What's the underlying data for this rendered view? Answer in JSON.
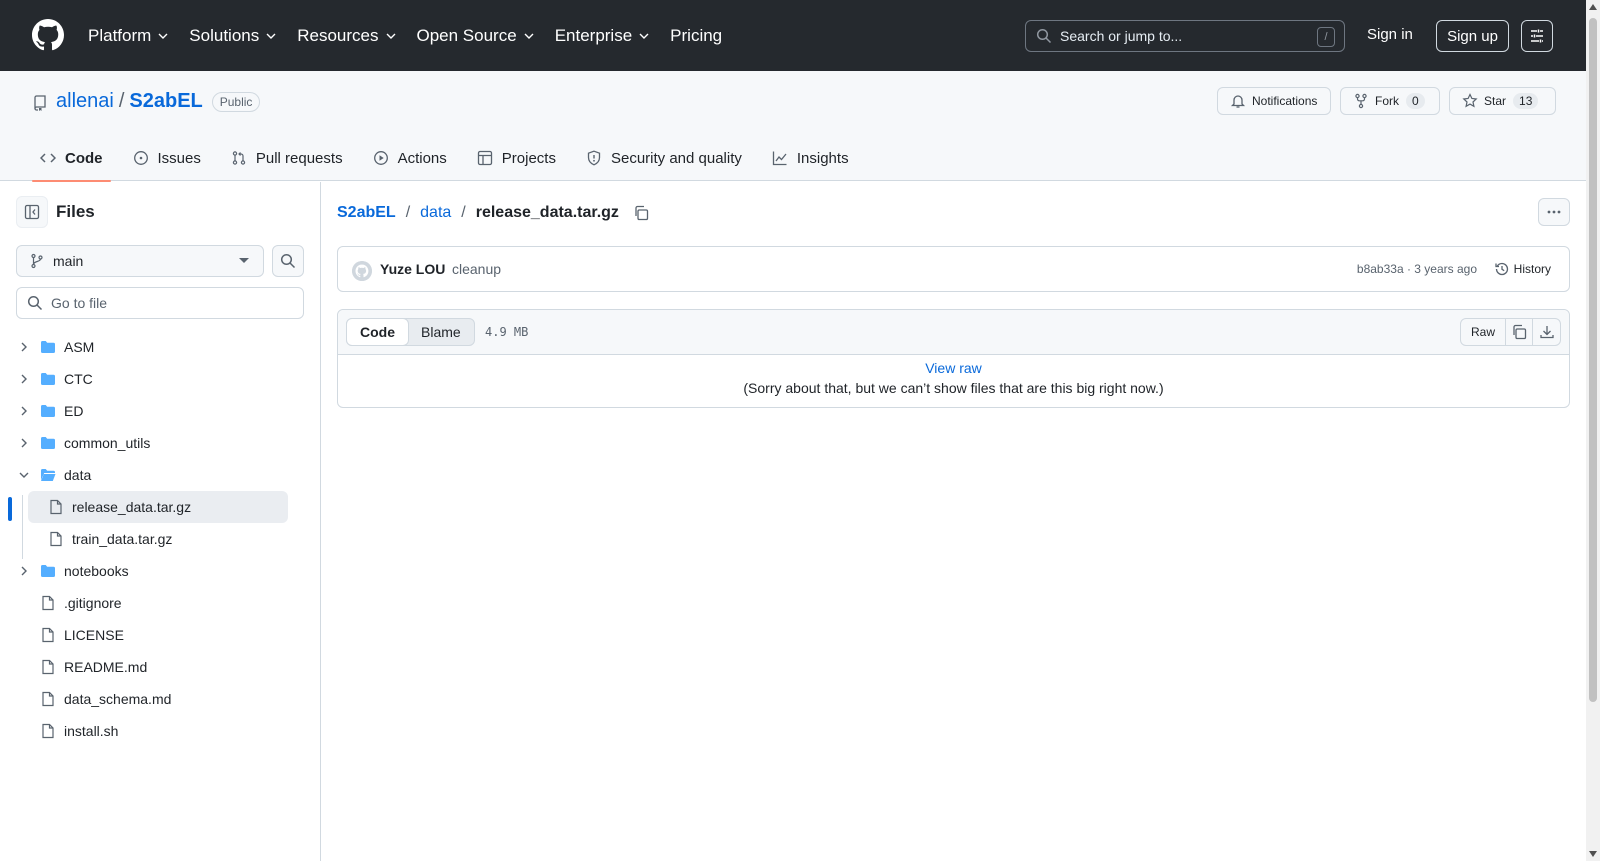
{
  "header": {
    "nav": [
      "Platform",
      "Solutions",
      "Resources",
      "Open Source",
      "Enterprise",
      "Pricing"
    ],
    "search_placeholder": "Search or jump to...",
    "search_shortcut": "/",
    "sign_in": "Sign in",
    "sign_up": "Sign up"
  },
  "repo": {
    "owner": "allenai",
    "separator": "/",
    "name": "S2abEL",
    "visibility": "Public",
    "notifications_label": "Notifications",
    "fork_label": "Fork",
    "fork_count": "0",
    "star_label": "Star",
    "star_count": "13",
    "tabs": [
      "Code",
      "Issues",
      "Pull requests",
      "Actions",
      "Projects",
      "Security and quality",
      "Insights"
    ]
  },
  "sidebar": {
    "title": "Files",
    "branch": "main",
    "goto_placeholder": "Go to file",
    "tree": [
      {
        "name": "ASM",
        "type": "folder"
      },
      {
        "name": "CTC",
        "type": "folder"
      },
      {
        "name": "ED",
        "type": "folder"
      },
      {
        "name": "common_utils",
        "type": "folder"
      },
      {
        "name": "data",
        "type": "folder-open"
      },
      {
        "name": "release_data.tar.gz",
        "type": "file"
      },
      {
        "name": "train_data.tar.gz",
        "type": "file"
      },
      {
        "name": "notebooks",
        "type": "folder"
      },
      {
        "name": ".gitignore",
        "type": "file"
      },
      {
        "name": "LICENSE",
        "type": "file"
      },
      {
        "name": "README.md",
        "type": "file"
      },
      {
        "name": "data_schema.md",
        "type": "file"
      },
      {
        "name": "install.sh",
        "type": "file"
      }
    ]
  },
  "breadcrumb": {
    "repo": "S2abEL",
    "folder": "data",
    "file": "release_data.tar.gz",
    "sep": "/"
  },
  "commit": {
    "author": "Yuze LOU",
    "message": "cleanup",
    "meta": "b8ab33a · 3 years ago",
    "history_label": "History"
  },
  "file": {
    "code_tab": "Code",
    "blame_tab": "Blame",
    "size": "4.9 MB",
    "raw_label": "Raw",
    "view_raw": "View raw",
    "too_big_msg": "(Sorry about that, but we can’t show files that are this big right now.)"
  },
  "colors": {
    "header_bg": "#25292e",
    "link": "#0969da",
    "folder": "#54aeff",
    "active_tab_underline": "#fd8c73"
  }
}
